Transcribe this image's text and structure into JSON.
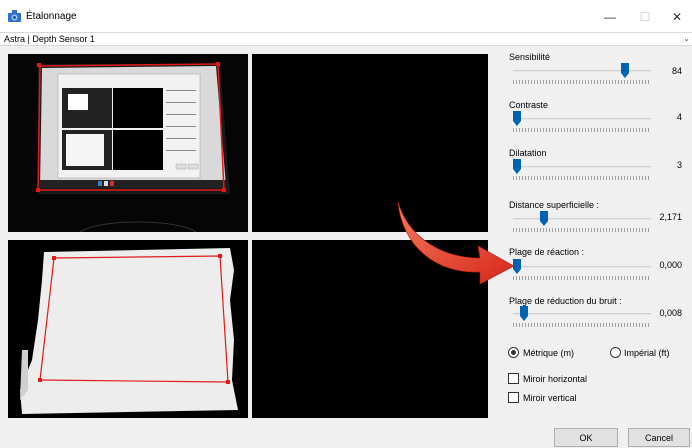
{
  "window": {
    "title": "Étalonnage",
    "minimize_glyph": "—",
    "maximize_glyph": "☐",
    "close_glyph": "✕",
    "icon": "calibration-app-icon"
  },
  "device": {
    "selected": "Astra | Depth Sensor 1",
    "arrow": "⌄"
  },
  "views": [
    "camera-view",
    "empty-view-top-right",
    "depth-view",
    "empty-view-bottom-right"
  ],
  "sliders": [
    {
      "label": "Sensibilité",
      "value": "84",
      "fraction": 0.83
    },
    {
      "label": "Contraste",
      "value": "4",
      "fraction": 0.0
    },
    {
      "label": "Dilatation",
      "value": "3",
      "fraction": 0.0
    },
    {
      "label": "Distance superficielle :",
      "value": "2,171",
      "fraction": 0.21
    },
    {
      "label": "Plage de réaction :",
      "value": "0,000",
      "fraction": 0.0
    },
    {
      "label": "Plage de réduction du bruit :",
      "value": "0,008",
      "fraction": 0.05
    }
  ],
  "units": {
    "metric": "Métrique (m)",
    "imperial": "Impérial (ft)",
    "selected": "metric"
  },
  "options": {
    "mirror_horizontal": "Miroir horizontal",
    "mirror_vertical": "Miroir vertical",
    "mirror_horizontal_checked": false,
    "mirror_vertical_checked": false
  },
  "buttons": {
    "ok": "OK",
    "cancel": "Cancel"
  },
  "colors": {
    "accent": "#0063b1",
    "outline": "#e01a1a",
    "arrow": "#e8321e"
  }
}
